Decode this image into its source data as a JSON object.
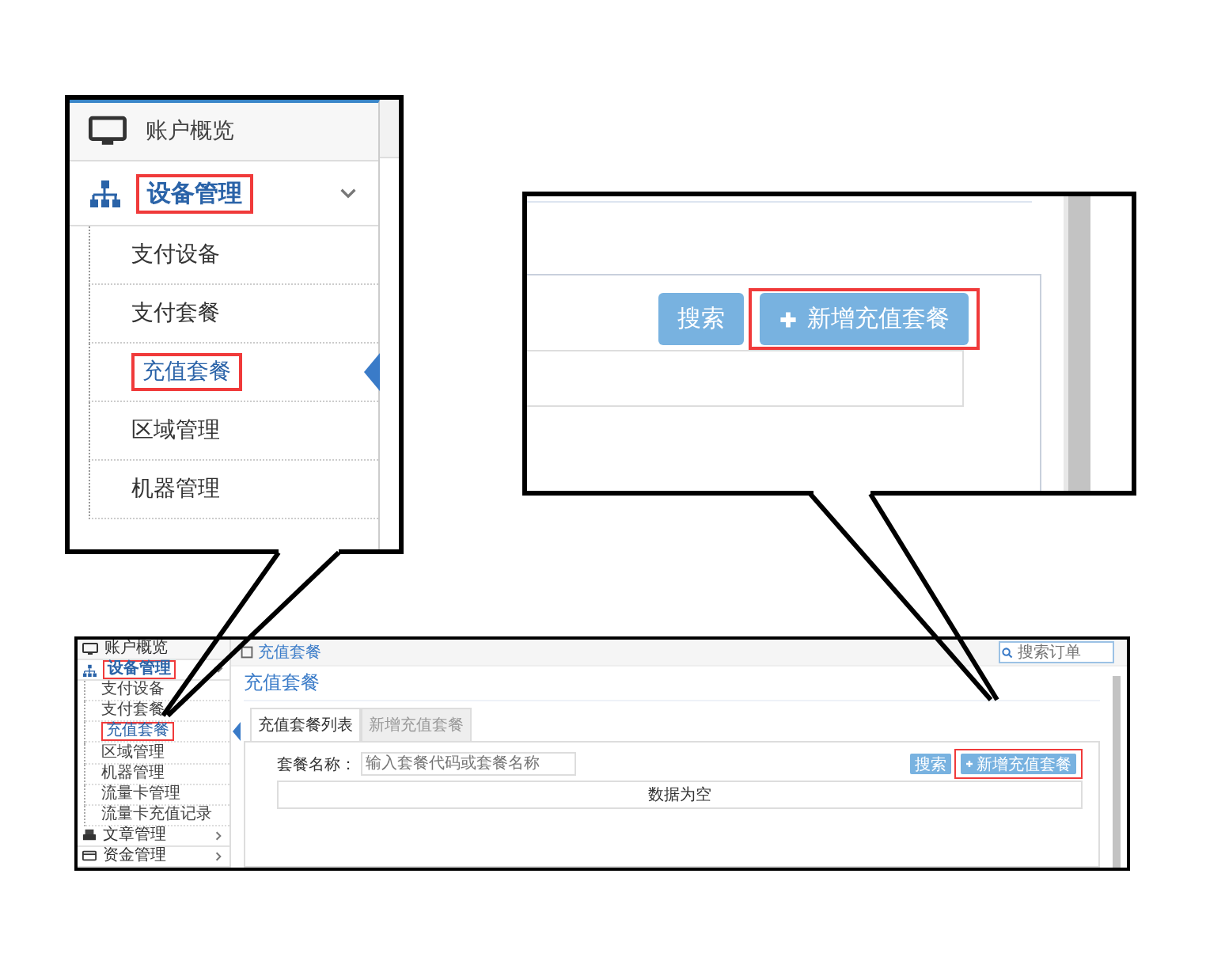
{
  "zoom_sidebar": {
    "items": [
      {
        "label": "账户概览",
        "kind": "top"
      },
      {
        "label": "设备管理",
        "kind": "group",
        "expanded": true,
        "highlighted": true,
        "children": [
          {
            "label": "支付设备",
            "selected": false,
            "highlighted": false
          },
          {
            "label": "支付套餐",
            "selected": false,
            "highlighted": false
          },
          {
            "label": "充值套餐",
            "selected": true,
            "highlighted": true
          },
          {
            "label": "区域管理",
            "selected": false,
            "highlighted": false
          },
          {
            "label": "机器管理",
            "selected": false,
            "highlighted": false
          }
        ]
      }
    ]
  },
  "zoom_toolbar": {
    "buttons": [
      {
        "label": "搜索",
        "kind": "search",
        "highlighted": false
      },
      {
        "label": "新增充值套餐",
        "kind": "add",
        "highlighted": true
      }
    ]
  },
  "screenshot": {
    "sidebar": {
      "items": [
        {
          "label": "账户概览",
          "kind": "top"
        },
        {
          "label": "设备管理",
          "kind": "group",
          "expanded": true,
          "highlighted": true,
          "children": [
            {
              "label": "支付设备",
              "selected": false,
              "highlighted": false
            },
            {
              "label": "支付套餐",
              "selected": false,
              "highlighted": false
            },
            {
              "label": "充值套餐",
              "selected": true,
              "highlighted": true
            },
            {
              "label": "区域管理",
              "selected": false,
              "highlighted": false
            },
            {
              "label": "机器管理",
              "selected": false,
              "highlighted": false
            },
            {
              "label": "流量卡管理",
              "selected": false,
              "highlighted": false
            },
            {
              "label": "流量卡充值记录",
              "selected": false,
              "highlighted": false
            }
          ]
        },
        {
          "label": "文章管理",
          "kind": "group",
          "expanded": false,
          "highlighted": false
        },
        {
          "label": "资金管理",
          "kind": "group",
          "expanded": false,
          "highlighted": false
        }
      ]
    },
    "breadcrumb": "充值套餐",
    "search": {
      "placeholder": "搜索订单"
    },
    "page_title": "充值套餐",
    "tabs": [
      {
        "label": "充值套餐列表",
        "selected": true
      },
      {
        "label": "新增充值套餐",
        "selected": false
      }
    ],
    "filter": {
      "label": "套餐名称：",
      "placeholder": "输入套餐代码或套餐名称"
    },
    "buttons": [
      {
        "label": "搜索",
        "kind": "search",
        "highlighted": false
      },
      {
        "label": "新增充值套餐",
        "kind": "add",
        "highlighted": true
      }
    ],
    "empty_message": "数据为空"
  }
}
